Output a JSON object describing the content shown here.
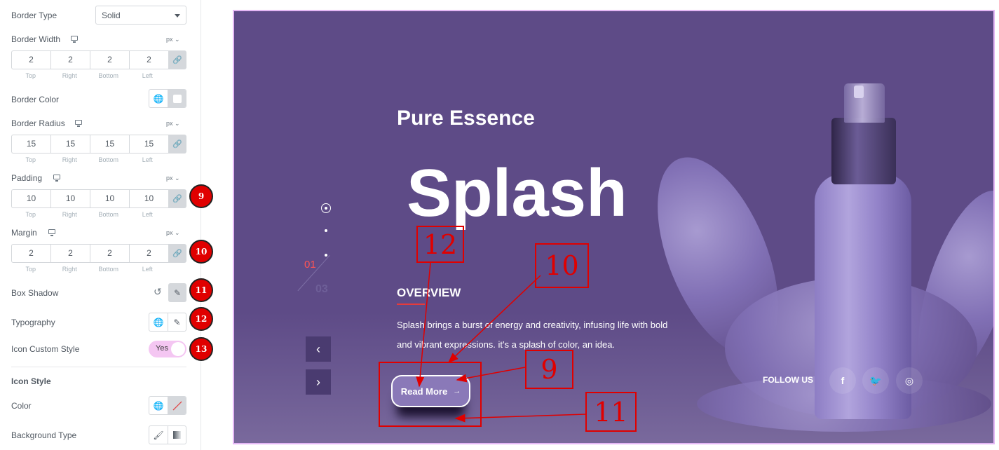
{
  "panel": {
    "border_type": {
      "label": "Border Type",
      "value": "Solid"
    },
    "border_width": {
      "label": "Border Width",
      "unit": "px",
      "values": [
        "2",
        "2",
        "2",
        "2"
      ]
    },
    "sides": [
      "Top",
      "Right",
      "Bottom",
      "Left"
    ],
    "border_color": {
      "label": "Border Color"
    },
    "border_radius": {
      "label": "Border Radius",
      "unit": "px",
      "values": [
        "15",
        "15",
        "15",
        "15"
      ]
    },
    "padding": {
      "label": "Padding",
      "unit": "px",
      "values": [
        "10",
        "10",
        "10",
        "10"
      ]
    },
    "margin": {
      "label": "Margin",
      "unit": "px",
      "values": [
        "2",
        "2",
        "2",
        "2"
      ]
    },
    "box_shadow": {
      "label": "Box Shadow"
    },
    "typography": {
      "label": "Typography"
    },
    "icon_custom_style": {
      "label": "Icon Custom Style",
      "toggle": "Yes"
    },
    "icon_style": {
      "title": "Icon Style"
    },
    "color": {
      "label": "Color"
    },
    "background_type": {
      "label": "Background Type"
    }
  },
  "badges": [
    "9",
    "10",
    "11",
    "12",
    "13"
  ],
  "preview": {
    "subtitle": "Pure Essence",
    "title": "Splash",
    "overview": "OVERVIEW",
    "description": "Splash brings a burst of energy and creativity, infusing life with bold and vibrant expressions. it's a splash of color, an idea.",
    "button": "Read More",
    "slide_current": "01",
    "slide_total": "03",
    "follow": "FOLLOW US"
  },
  "annotations": [
    "12",
    "10",
    "9",
    "11"
  ],
  "colors": {
    "accent": "#e00000",
    "preview_bg": "#5e4b87",
    "toggle": "#f4c6f2"
  }
}
